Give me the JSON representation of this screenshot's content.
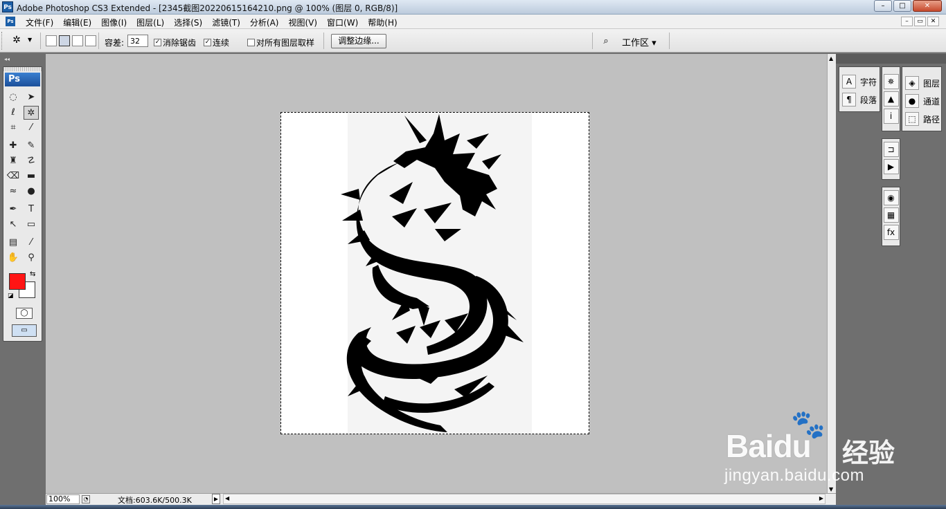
{
  "window": {
    "title": "Adobe Photoshop CS3 Extended - [2345截图20220615164210.png @ 100% (图层 0, RGB/8)]",
    "app_icon": "Ps",
    "minimize": "–",
    "maximize": "□",
    "close": "✕"
  },
  "menu": {
    "items": [
      "文件(F)",
      "编辑(E)",
      "图像(I)",
      "图层(L)",
      "选择(S)",
      "滤镜(T)",
      "分析(A)",
      "视图(V)",
      "窗口(W)",
      "帮助(H)"
    ],
    "doc_minimize": "–",
    "doc_restore": "▭",
    "doc_close": "✕"
  },
  "options": {
    "tool_icon": "magic-wand-icon",
    "tolerance_label": "容差:",
    "tolerance_value": "32",
    "antialias_label": "消除锯齿",
    "antialias_checked": true,
    "contiguous_label": "连续",
    "contiguous_checked": true,
    "sample_all_label": "对所有图层取样",
    "sample_all_checked": false,
    "refine_edge_label": "调整边缘...",
    "workspace_label": "工作区"
  },
  "toolbox": {
    "logo": "Ps",
    "foreground_color": "#ff1414",
    "background_color": "#ffffff"
  },
  "status": {
    "zoom": "100%",
    "doc_info": "文档:603.6K/500.3K"
  },
  "panels": {
    "character_label": "字符",
    "paragraph_label": "段落",
    "layers_label": "图层",
    "channels_label": "通道",
    "paths_label": "路径"
  },
  "watermark": {
    "brand": "Baidu",
    "cn": "经验",
    "url": "jingyan.baidu.com"
  }
}
